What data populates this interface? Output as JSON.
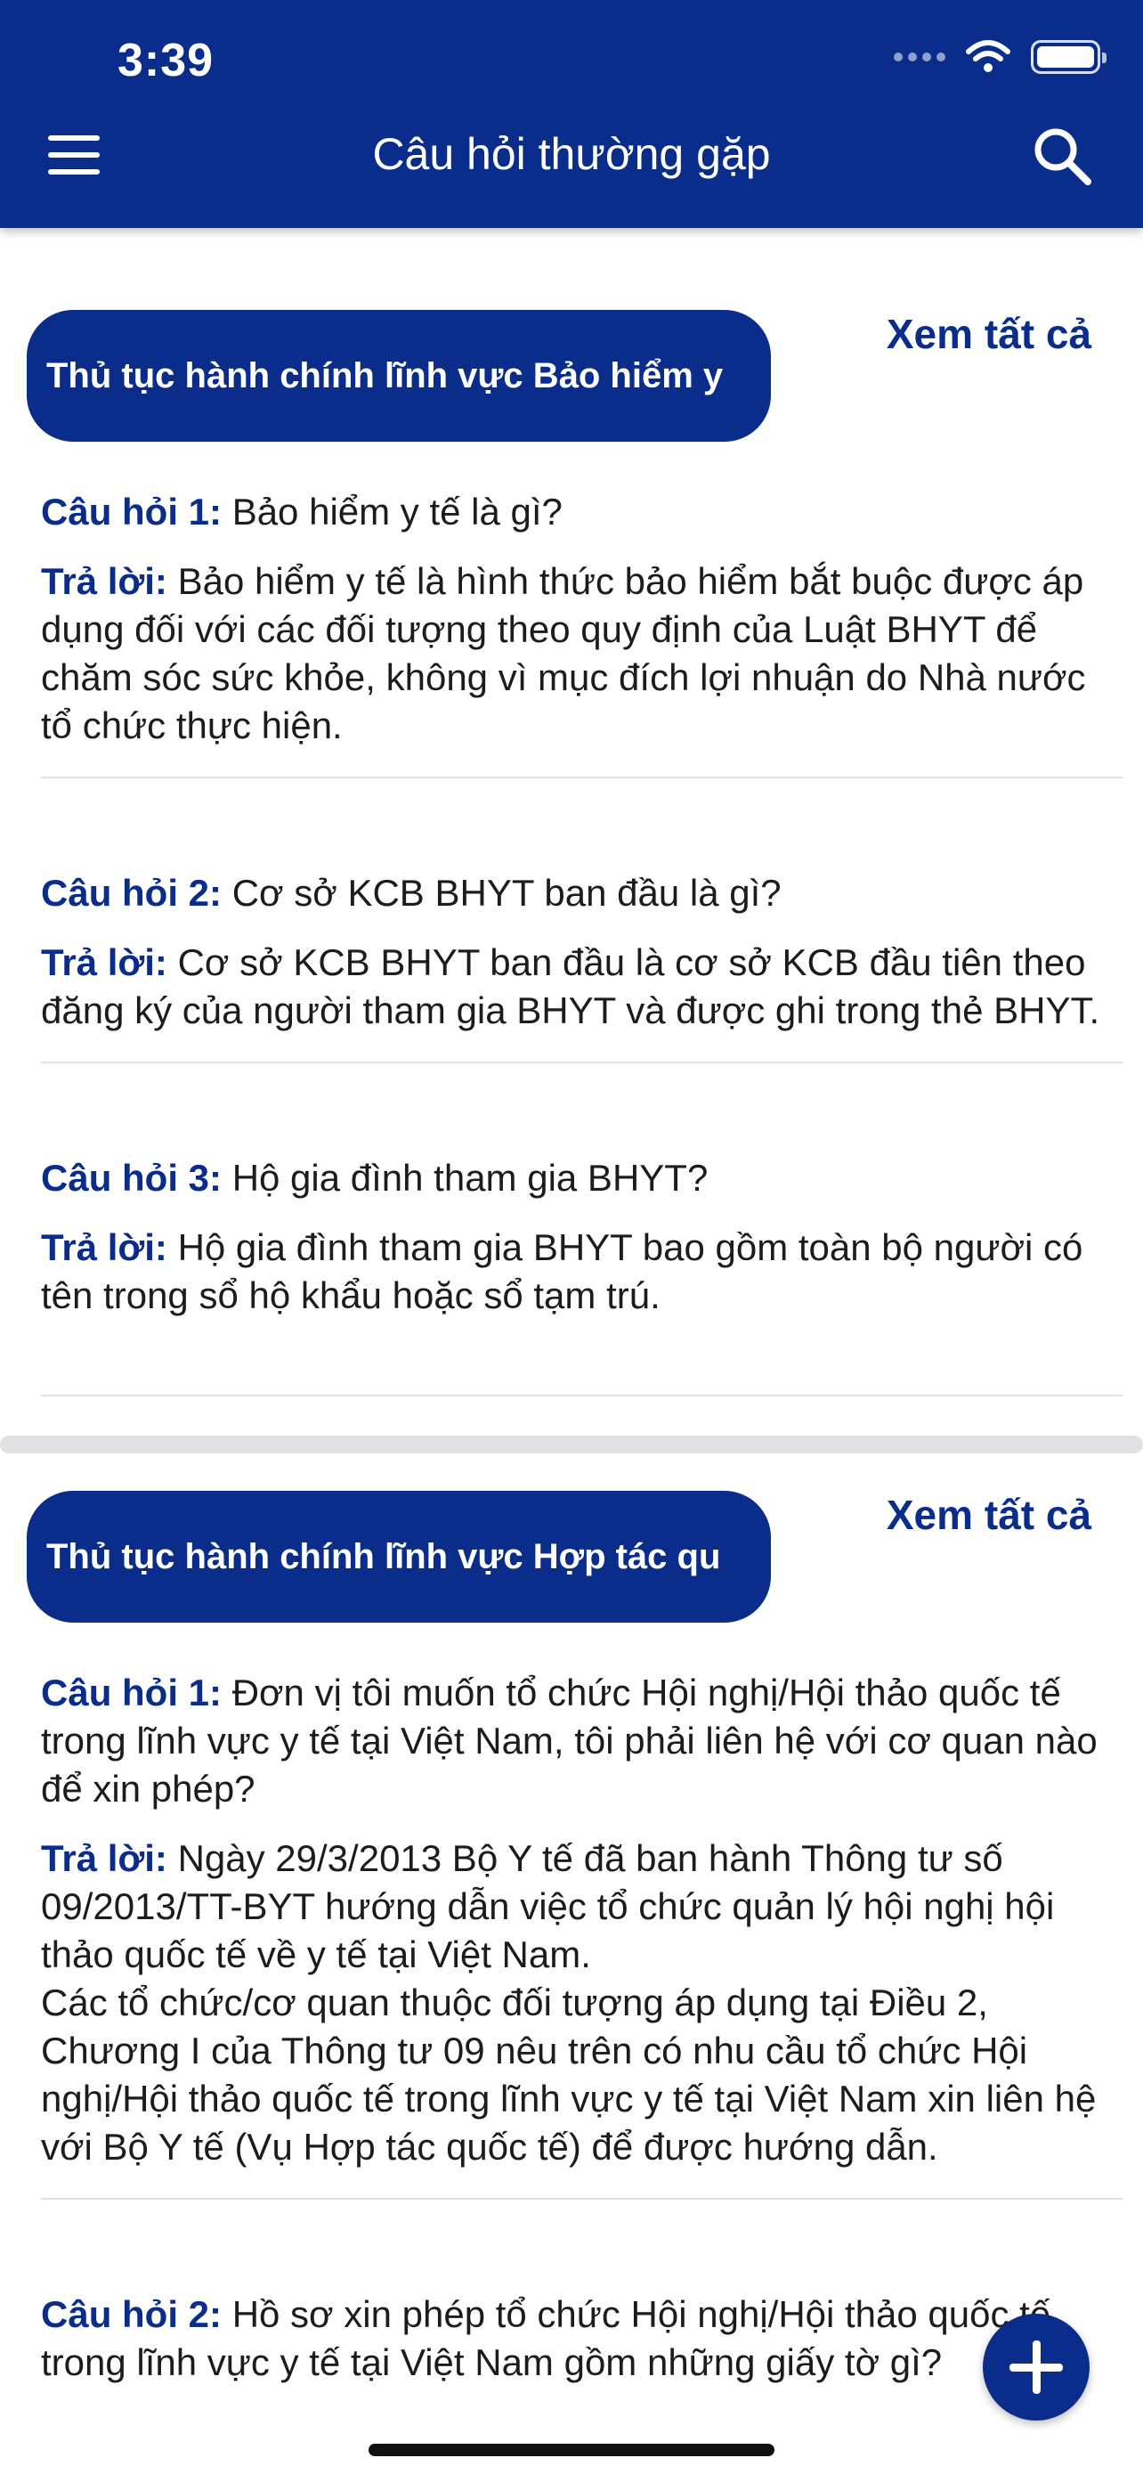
{
  "status_bar": {
    "time": "3:39"
  },
  "header": {
    "title": "Câu hỏi thường gặp"
  },
  "icons": {
    "menu": "hamburger-menu-icon",
    "search": "search-icon",
    "add": "plus-icon"
  },
  "colors": {
    "primary": "#0a2d8c",
    "divider": "#e3e3e6",
    "background": "#ffffff"
  },
  "sections": [
    {
      "category": "Thủ tục hành chính lĩnh vực Bảo hiểm y",
      "see_all": "Xem tất cả",
      "items": [
        {
          "q_label": "Câu hỏi 1:",
          "question": "Bảo hiểm y tế là gì?",
          "a_label": "Trả lời:",
          "answer": "Bảo hiểm y tế là hình thức bảo hiểm bắt buộc được áp dụng đối với các đối tượng theo quy định của Luật BHYT để chăm sóc sức khỏe, không vì mục đích lợi nhuận do Nhà nước tổ chức thực hiện."
        },
        {
          "q_label": "Câu hỏi 2:",
          "question": "Cơ sở KCB BHYT ban đầu là gì?",
          "a_label": "Trả lời:",
          "answer": "Cơ sở KCB BHYT ban đầu là cơ sở KCB đầu tiên theo đăng ký của người tham gia BHYT và được ghi trong thẻ BHYT."
        },
        {
          "q_label": "Câu hỏi 3:",
          "question": "Hộ gia đình tham gia BHYT?",
          "a_label": "Trả lời:",
          "answer": "Hộ gia đình tham gia BHYT bao gồm toàn bộ người có tên trong sổ hộ khẩu hoặc sổ tạm trú."
        }
      ]
    },
    {
      "category": "Thủ tục hành chính lĩnh vực Hợp tác qu",
      "see_all": "Xem tất cả",
      "items": [
        {
          "q_label": "Câu hỏi 1:",
          "question": "Đơn vị tôi muốn tổ chức Hội nghị/Hội thảo quốc tế trong lĩnh vực y tế tại Việt Nam, tôi phải liên hệ với cơ quan nào để xin phép?",
          "a_label": "Trả lời:",
          "answer": "Ngày 29/3/2013 Bộ Y tế đã ban hành Thông tư số 09/2013/TT-BYT hướng dẫn việc tổ chức quản lý hội nghị hội thảo quốc tế về y tế tại Việt Nam.",
          "answer_2": "Các tổ chức/cơ quan thuộc đối tượng áp dụng tại Điều 2, Chương I của Thông tư 09 nêu trên có nhu cầu tổ chức Hội nghị/Hội thảo quốc tế trong lĩnh vực y tế tại Việt Nam xin liên hệ với Bộ Y tế (Vụ Hợp tác quốc tế) để được hướng dẫn."
        },
        {
          "q_label": "Câu hỏi 2:",
          "question": "Hồ sơ xin phép tổ chức Hội nghị/Hội thảo quốc tế trong lĩnh vực y tế tại Việt Nam gồm những giấy tờ gì?"
        }
      ]
    }
  ]
}
